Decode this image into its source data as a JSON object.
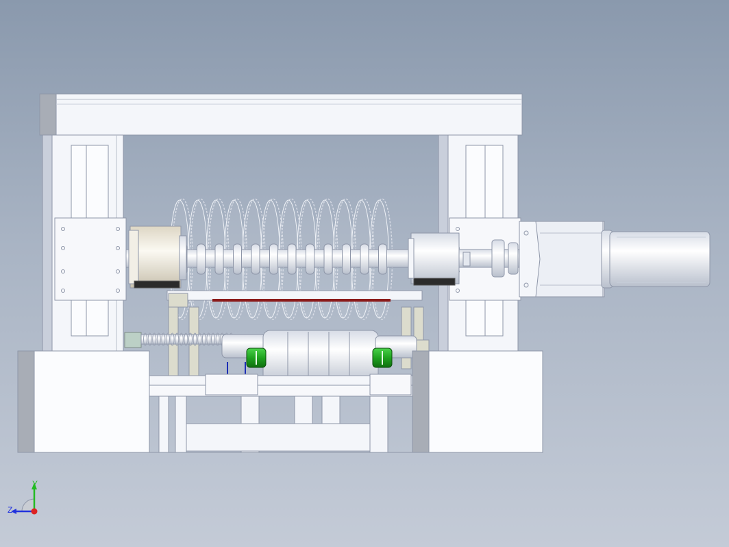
{
  "viewport": {
    "background_top": "#8a99ad",
    "background_bottom": "#c4cbd7"
  },
  "model": {
    "blade_count": 12,
    "colors": {
      "body": "#f4f6fa",
      "edge": "#8e96a8",
      "shadow": "#c9cfdb",
      "dark_face": "#a8adb6",
      "motor_coupling": "#1fa31f",
      "accent_red": "#8b1a1a",
      "accent_blue": "#1c2fb5"
    }
  },
  "triad": {
    "x_label": "",
    "y_label": "Y",
    "z_label": "Z",
    "y_color": "#22bb22",
    "z_color": "#2233dd",
    "x_color": "#dd2222"
  }
}
